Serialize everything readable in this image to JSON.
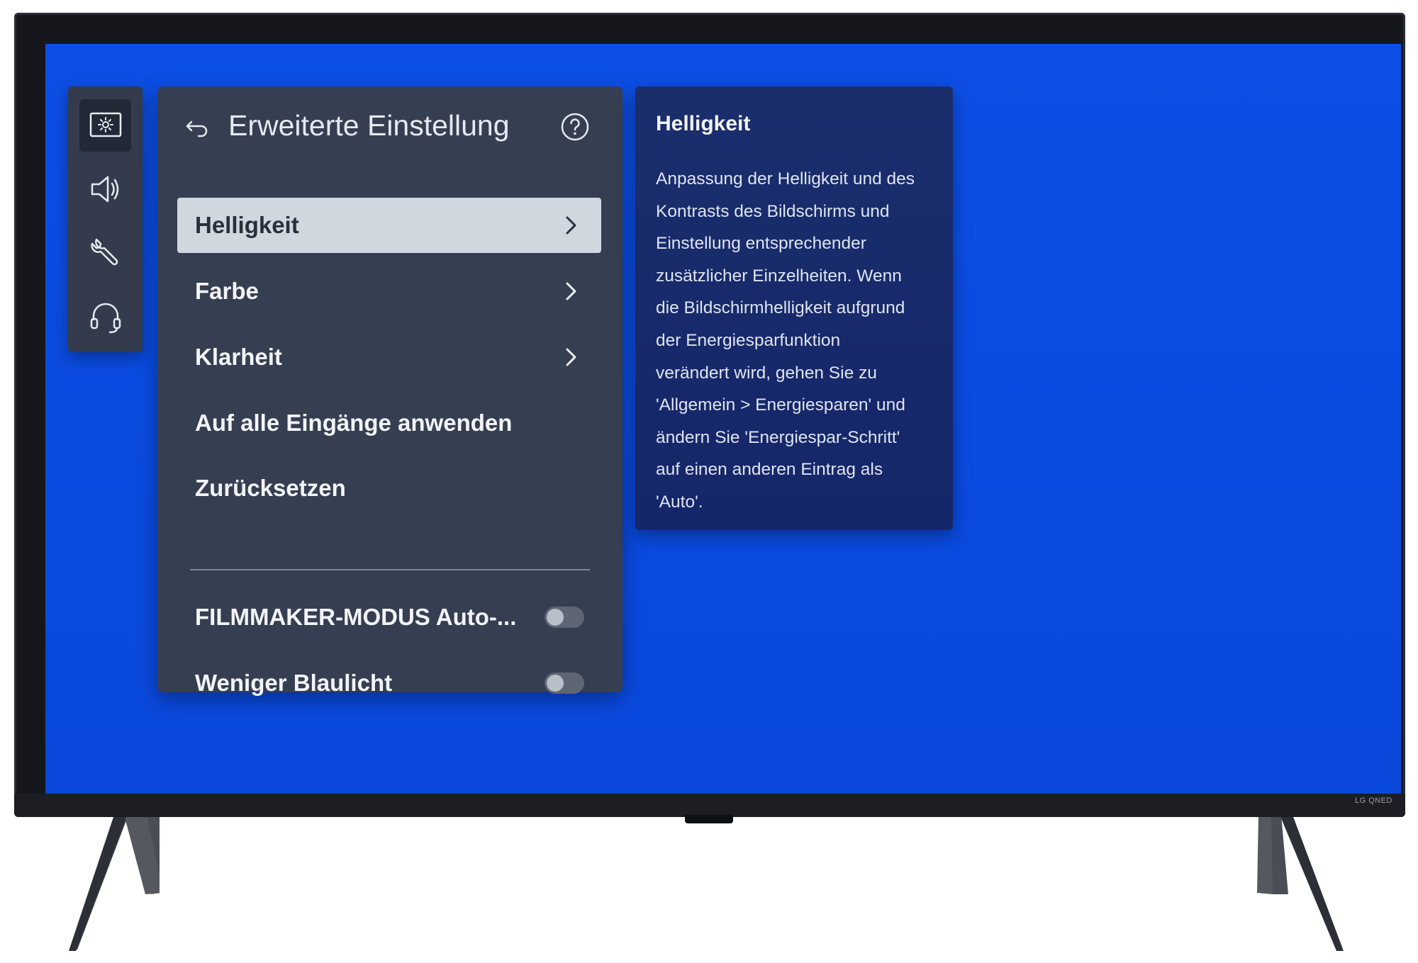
{
  "device": {
    "brand_label": "LG QNED"
  },
  "rail": {
    "items": [
      {
        "icon": "picture-settings-icon",
        "active": true
      },
      {
        "icon": "speaker-icon",
        "active": false
      },
      {
        "icon": "wrench-icon",
        "active": false
      },
      {
        "icon": "headset-icon",
        "active": false
      }
    ]
  },
  "panel": {
    "title": "Erweiterte Einstellung",
    "back_icon": "back-arrow-icon",
    "help_icon": "help-icon",
    "menu": [
      {
        "label": "Helligkeit",
        "has_submenu": true,
        "selected": true
      },
      {
        "label": "Farbe",
        "has_submenu": true,
        "selected": false
      },
      {
        "label": "Klarheit",
        "has_submenu": true,
        "selected": false
      },
      {
        "label": "Auf alle Eingänge anwenden",
        "has_submenu": false,
        "selected": false
      },
      {
        "label": "Zurücksetzen",
        "has_submenu": false,
        "selected": false
      }
    ],
    "toggles": [
      {
        "label": "FILMMAKER-MODUS Auto-...",
        "on": false
      },
      {
        "label": "Weniger Blaulicht",
        "on": false
      }
    ]
  },
  "description": {
    "title": "Helligkeit",
    "lines": [
      "Anpassung der Helligkeit und des",
      "Kontrasts des Bildschirms und",
      "Einstellung entsprechender",
      "zusätzlicher Einzelheiten. Wenn",
      "die Bildschirmhelligkeit aufgrund",
      "der Energiesparfunktion",
      "verändert wird, gehen Sie zu",
      "'Allgemein > Energiesparen' und",
      "ändern Sie 'Energiespar-Schritt'",
      "auf einen anderen Eintrag als",
      "'Auto'."
    ]
  },
  "colors": {
    "screen_background": "#0a4be0",
    "panel_background": "#363e51",
    "description_background": "#1a2e6c",
    "selected_item": "#d0d7df"
  }
}
